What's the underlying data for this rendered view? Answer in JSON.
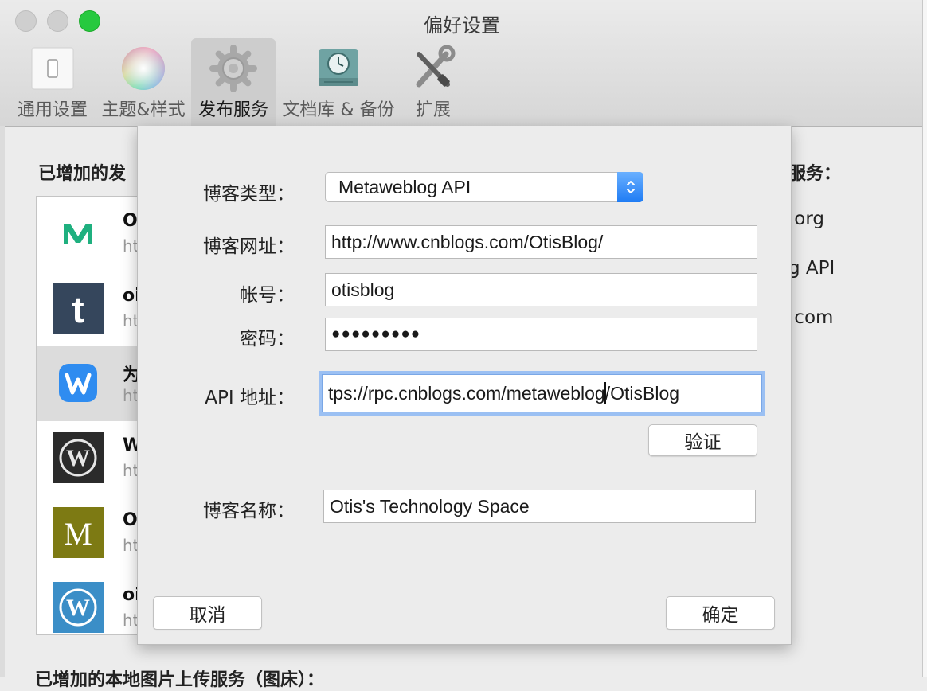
{
  "window": {
    "title": "偏好设置"
  },
  "toolbar": {
    "items": [
      {
        "label": "通用设置",
        "icon": "switch-icon"
      },
      {
        "label": "主题&样式",
        "icon": "color-wheel-icon"
      },
      {
        "label": "发布服务",
        "icon": "gear-icon",
        "active": true
      },
      {
        "label": "文档库 & 备份",
        "icon": "time-machine-icon"
      },
      {
        "label": "扩展",
        "icon": "tools-icon"
      }
    ]
  },
  "background": {
    "heading_left": "已增加的发",
    "heading_right": "服务：",
    "right_items": [
      ".org",
      "g API",
      ".com"
    ],
    "bottom_heading": "已增加的本地图片上传服务（图床）：",
    "accounts": [
      {
        "name": "O",
        "sub": "ht",
        "icon": "medium-icon"
      },
      {
        "name": "oi",
        "sub": "ht",
        "icon": "tumblr-icon"
      },
      {
        "name": "为",
        "sub": "ht",
        "icon": "wiz-icon",
        "selected": true
      },
      {
        "name": "W",
        "sub": "ht",
        "icon": "wordpress-dark-icon"
      },
      {
        "name": "O",
        "sub": "ht",
        "icon": "movable-type-icon"
      },
      {
        "name": "oi",
        "sub": "ht",
        "icon": "wordpress-blue-icon"
      }
    ]
  },
  "sheet": {
    "blog_type": {
      "label": "博客类型：",
      "value": "Metaweblog API"
    },
    "blog_url": {
      "label": "博客网址：",
      "value": "http://www.cnblogs.com/OtisBlog/"
    },
    "account": {
      "label": "帐号：",
      "value": "otisblog"
    },
    "password": {
      "label": "密码：",
      "value": "●●●●●●●●●"
    },
    "api_url": {
      "label": "API 地址：",
      "value_before_caret": "tps://rpc.cnblogs.com/metaweblog",
      "value_after_caret": "/OtisBlog"
    },
    "verify_button": "验证",
    "blog_name": {
      "label": "博客名称：",
      "value": "Otis's Technology Space"
    },
    "cancel_button": "取消",
    "ok_button": "确定"
  },
  "colors": {
    "accent": "#1f7cf4",
    "focus_ring": "#9bc0f3"
  }
}
